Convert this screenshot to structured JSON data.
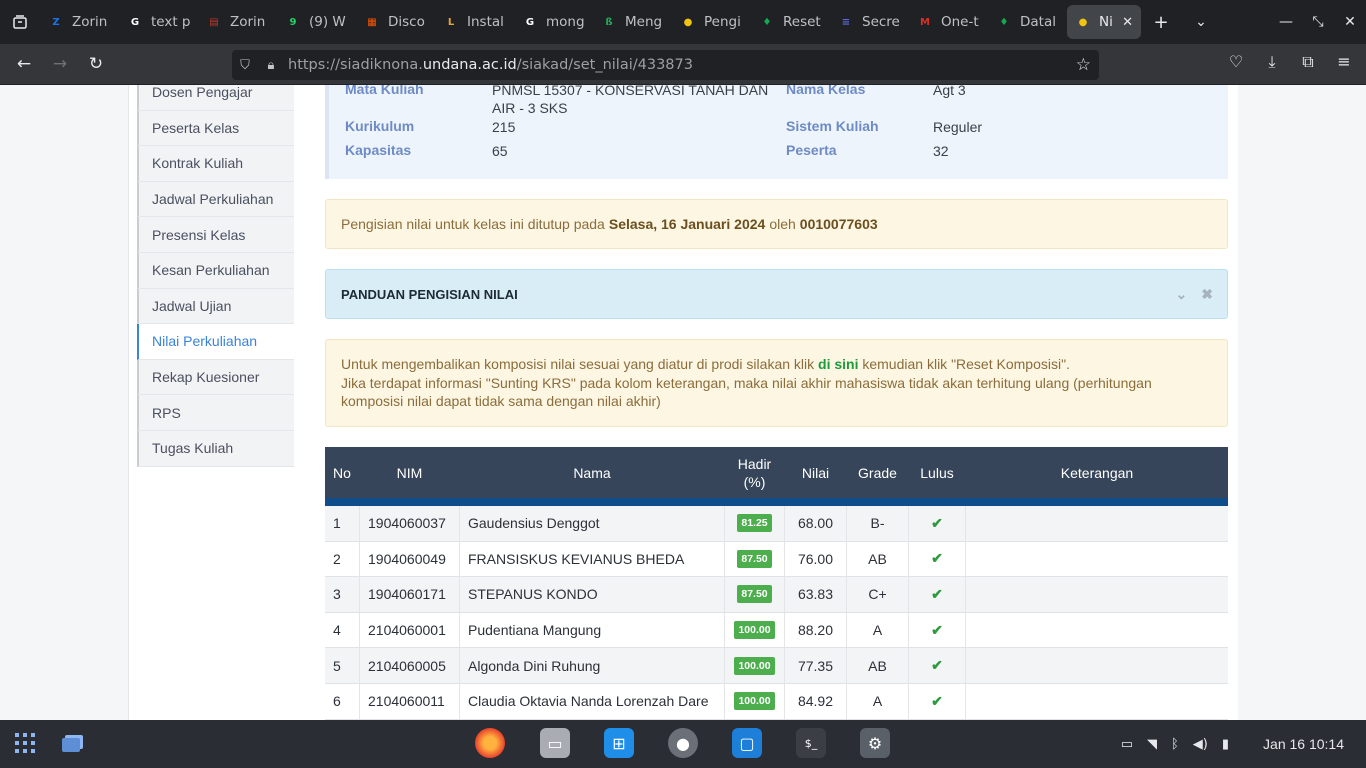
{
  "browser": {
    "tabs": [
      {
        "title": "Zorin",
        "color": "#1a73e8",
        "glyph": "Z"
      },
      {
        "title": "text p",
        "color": "#ffffff",
        "glyph": "G"
      },
      {
        "title": "Zorin",
        "color": "#c0392b",
        "glyph": "▤"
      },
      {
        "title": "(9) W",
        "color": "#25d366",
        "glyph": "9"
      },
      {
        "title": "Disco",
        "color": "#ff5500",
        "glyph": "▦"
      },
      {
        "title": "Instal",
        "color": "#e8a33d",
        "glyph": "L"
      },
      {
        "title": "mong",
        "color": "#ffffff",
        "glyph": "G"
      },
      {
        "title": "Meng",
        "color": "#22aa55",
        "glyph": "ß"
      },
      {
        "title": "Pengi",
        "color": "#f1c40f",
        "glyph": "●"
      },
      {
        "title": "Reset",
        "color": "#13aa52",
        "glyph": "♦"
      },
      {
        "title": "Secre",
        "color": "#5b6bdc",
        "glyph": "≡"
      },
      {
        "title": "One-t",
        "color": "#d93025",
        "glyph": "M"
      },
      {
        "title": "Datal",
        "color": "#13aa52",
        "glyph": "♦"
      },
      {
        "title": "Nila",
        "color": "#f1c40f",
        "glyph": "●"
      }
    ],
    "url_prefix": "https://siadiknona.",
    "url_domain": "undana.ac.id",
    "url_path": "/siakad/set_nilai/433873"
  },
  "sidebar": {
    "items": [
      {
        "label": "Dosen Pengajar"
      },
      {
        "label": "Peserta Kelas"
      },
      {
        "label": "Kontrak Kuliah"
      },
      {
        "label": "Jadwal Perkuliahan"
      },
      {
        "label": "Presensi Kelas"
      },
      {
        "label": "Kesan Perkuliahan"
      },
      {
        "label": "Jadwal Ujian"
      },
      {
        "label": "Nilai Perkuliahan"
      },
      {
        "label": "Rekap Kuesioner"
      },
      {
        "label": "RPS"
      },
      {
        "label": "Tugas Kuliah"
      }
    ],
    "active": "Nilai Perkuliahan"
  },
  "course_info": {
    "mata_kuliah_label": "Mata Kuliah",
    "mata_kuliah_value_1": "PNMSL 15307 - KONSERVASI TANAH DAN",
    "mata_kuliah_value_2": "AIR - 3 SKS",
    "nama_kelas_label": "Nama Kelas",
    "nama_kelas_value": "Agt 3",
    "kurikulum_label": "Kurikulum",
    "kurikulum_value": "215",
    "sistem_kuliah_label": "Sistem Kuliah",
    "sistem_kuliah_value": "Reguler",
    "kapasitas_label": "Kapasitas",
    "kapasitas_value": "65",
    "peserta_label": "Peserta",
    "peserta_value": "32"
  },
  "notice": {
    "prefix": "Pengisian nilai untuk kelas ini ditutup pada",
    "date": "Selasa, 16 Januari 2024",
    "mid": "oleh",
    "by": "0010077603"
  },
  "guide": {
    "title": "PANDUAN PENGISIAN NILAI"
  },
  "warning": {
    "line1_prefix": "Untuk mengembalikan komposisi nilai sesuai yang diatur di prodi silakan klik",
    "link": "di sini",
    "line1_suffix": "kemudian klik \"Reset Komposisi\".",
    "line2": "Jika terdapat informasi \"Sunting KRS\" pada kolom keterangan, maka nilai akhir mahasiswa tidak akan terhitung ulang (perhitungan komposisi nilai dapat tidak sama dengan nilai akhir)"
  },
  "table": {
    "headers": {
      "no": "No",
      "nim": "NIM",
      "nama": "Nama",
      "hadir_1": "Hadir",
      "hadir_2": "(%)",
      "nilai": "Nilai",
      "grade": "Grade",
      "lulus": "Lulus",
      "keterangan": "Keterangan"
    },
    "rows": [
      {
        "no": "1",
        "nim": "1904060037",
        "nama": "Gaudensius Denggot",
        "hadir": "81.25",
        "nilai": "68.00",
        "grade": "B-",
        "keterangan": ""
      },
      {
        "no": "2",
        "nim": "1904060049",
        "nama": "FRANSISKUS KEVIANUS BHEDA",
        "hadir": "87.50",
        "nilai": "76.00",
        "grade": "AB",
        "keterangan": ""
      },
      {
        "no": "3",
        "nim": "1904060171",
        "nama": "STEPANUS KONDO",
        "hadir": "87.50",
        "nilai": "63.83",
        "grade": "C+",
        "keterangan": ""
      },
      {
        "no": "4",
        "nim": "2104060001",
        "nama": "Pudentiana Mangung",
        "hadir": "100.00",
        "nilai": "88.20",
        "grade": "A",
        "keterangan": ""
      },
      {
        "no": "5",
        "nim": "2104060005",
        "nama": "Algonda Dini Ruhung",
        "hadir": "100.00",
        "nilai": "77.35",
        "grade": "AB",
        "keterangan": ""
      },
      {
        "no": "6",
        "nim": "2104060011",
        "nama": "Claudia Oktavia Nanda Lorenzah Dare",
        "hadir": "100.00",
        "nilai": "84.92",
        "grade": "A",
        "keterangan": ""
      }
    ]
  },
  "taskbar": {
    "clock": "Jan 16  10:14"
  },
  "colors": {
    "table_header_bg": "#364559",
    "accent": "#3a84d6",
    "badge_green": "#4cae4c"
  }
}
